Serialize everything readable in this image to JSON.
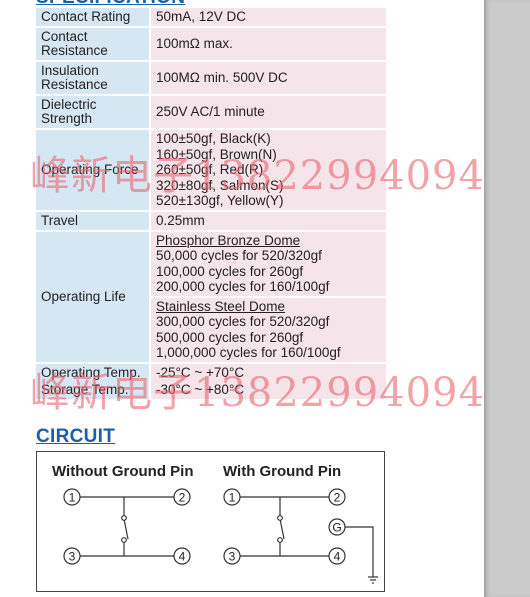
{
  "spec": {
    "heading": "SPECIFICATION",
    "rows": [
      {
        "key": "Contact Rating",
        "value": [
          "50mA, 12V DC"
        ]
      },
      {
        "key": "Contact Resistance",
        "value": [
          "100mΩ max."
        ]
      },
      {
        "key": "Insulation Resistance",
        "value": [
          "100MΩ min. 500V DC"
        ]
      },
      {
        "key": "Dielectric Strength",
        "value": [
          "250V AC/1 minute"
        ]
      },
      {
        "key": "Operating Force",
        "value": [
          "100±50gf, Black(K)",
          "160±50gf, Brown(N)",
          "260±50gf, Red(R)",
          "320±80gf, Salmon(S)",
          "520±130gf, Yellow(Y)"
        ]
      },
      {
        "key": "Travel",
        "value": [
          "0.25mm"
        ]
      }
    ],
    "operating_life": {
      "key": "Operating Life",
      "groups": [
        {
          "title": "Phosphor Bronze Dome",
          "lines": [
            "50,000 cycles for 520/320gf",
            "100,000 cycles for 260gf",
            "200,000 cycles for 160/100gf"
          ]
        },
        {
          "title": "Stainless Steel Dome",
          "lines": [
            "300,000 cycles for 520/320gf",
            "500,000 cycles for 260gf",
            "1,000,000 cycles for 160/100gf"
          ]
        }
      ]
    },
    "temps": [
      {
        "key": "Operating Temp.",
        "value": "-25°C ~ +70°C"
      },
      {
        "key": "Storage Temp.",
        "value": "-30°C ~ +80°C"
      }
    ]
  },
  "circuit": {
    "heading": "CIRCUIT",
    "without_title": "Without Ground Pin",
    "with_title": "With Ground Pin",
    "pins": [
      "1",
      "2",
      "3",
      "4"
    ],
    "ground_pin": "G"
  },
  "watermark": "峰新电子13822994094"
}
